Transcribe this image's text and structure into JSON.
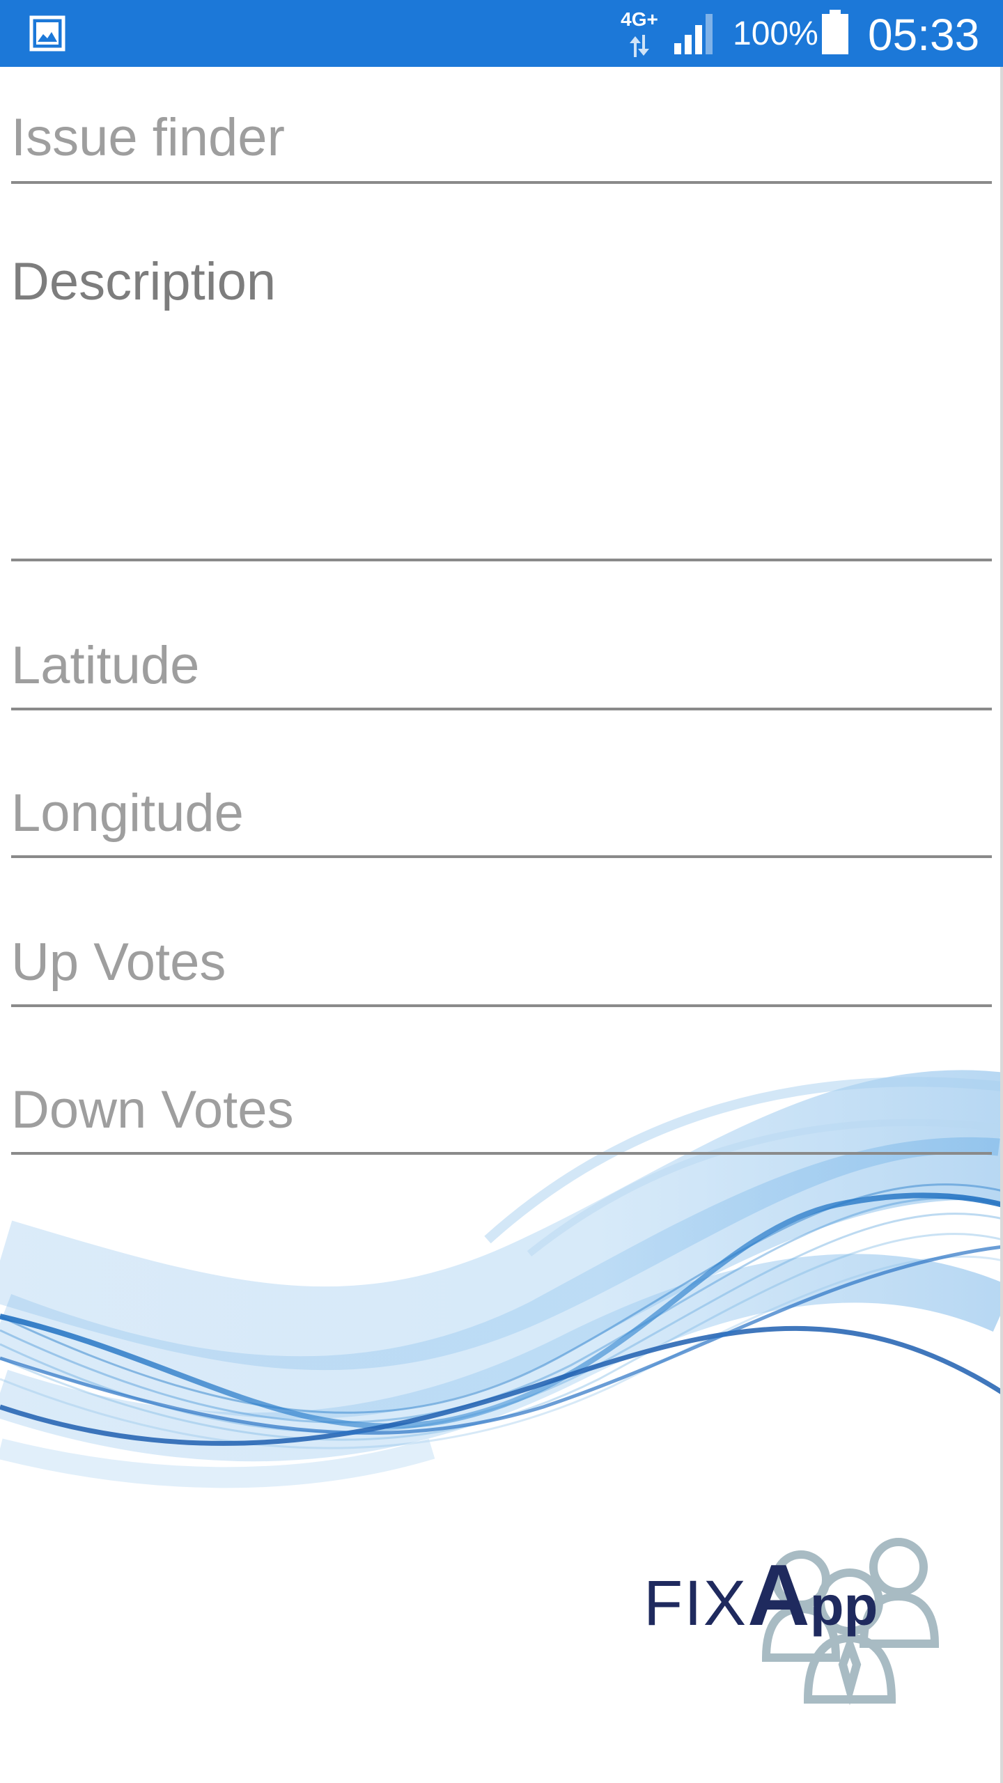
{
  "status_bar": {
    "network_type": "4G+",
    "battery_percent": "100%",
    "battery_level": 1.0,
    "time": "05:33",
    "background_color": "#1c78d8",
    "icons": [
      "gallery-notification-icon",
      "data-arrows-icon",
      "signal-strength-icon",
      "battery-icon"
    ]
  },
  "form": {
    "issue_finder": {
      "value": "",
      "placeholder": "Issue finder"
    },
    "description": {
      "value": "",
      "placeholder": "Description"
    },
    "latitude": {
      "value": "",
      "placeholder": "Latitude"
    },
    "longitude": {
      "value": "",
      "placeholder": "Longitude"
    },
    "up_votes": {
      "value": "",
      "placeholder": "Up Votes"
    },
    "down_votes": {
      "value": "",
      "placeholder": "Down Votes"
    }
  },
  "branding": {
    "logo_text": "FIXApp",
    "logo_color": "#1f2a5e",
    "wave_color": "#1f6fc0"
  }
}
